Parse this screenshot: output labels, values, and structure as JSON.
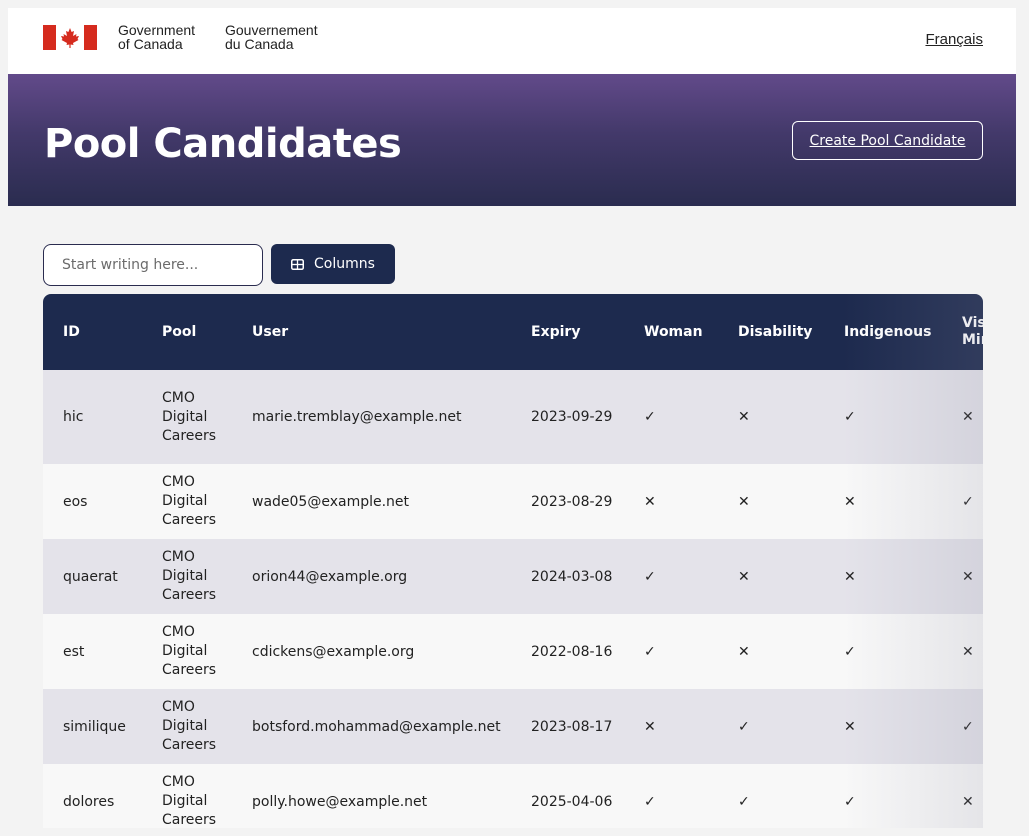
{
  "header": {
    "gov_en_line1": "Government",
    "gov_en_line2": "of Canada",
    "gov_fr_line1": "Gouvernement",
    "gov_fr_line2": "du Canada",
    "language_link": "Français",
    "flag_color": "#d52b1e"
  },
  "hero": {
    "title": "Pool Candidates",
    "create_button": "Create Pool Candidate"
  },
  "controls": {
    "search_placeholder": "Start writing here...",
    "columns_button": "Columns",
    "columns_icon": "table-icon"
  },
  "table": {
    "columns": [
      "ID",
      "Pool",
      "User",
      "Expiry",
      "Woman",
      "Disability",
      "Indigenous",
      "Visible Minority"
    ],
    "rows": [
      {
        "id": "hic",
        "pool": [
          "CMO",
          "Digital",
          "Careers"
        ],
        "user": "marie.tremblay@example.net",
        "expiry": "2023-09-29",
        "woman": "✓",
        "disability": "✕",
        "indigenous": "✓",
        "minority": "✕"
      },
      {
        "id": "eos",
        "pool": [
          "CMO",
          "Digital",
          "Careers"
        ],
        "user": "wade05@example.net",
        "expiry": "2023-08-29",
        "woman": "✕",
        "disability": "✕",
        "indigenous": "✕",
        "minority": "✓"
      },
      {
        "id": "quaerat",
        "pool": [
          "CMO",
          "Digital",
          "Careers"
        ],
        "user": "orion44@example.org",
        "expiry": "2024-03-08",
        "woman": "✓",
        "disability": "✕",
        "indigenous": "✕",
        "minority": "✕"
      },
      {
        "id": "est",
        "pool": [
          "CMO",
          "Digital",
          "Careers"
        ],
        "user": "cdickens@example.org",
        "expiry": "2022-08-16",
        "woman": "✓",
        "disability": "✕",
        "indigenous": "✓",
        "minority": "✕"
      },
      {
        "id": "similique",
        "pool": [
          "CMO",
          "Digital",
          "Careers"
        ],
        "user": "botsford.mohammad@example.net",
        "expiry": "2023-08-17",
        "woman": "✕",
        "disability": "✓",
        "indigenous": "✕",
        "minority": "✓"
      },
      {
        "id": "dolores",
        "pool": [
          "CMO",
          "Digital",
          "Careers"
        ],
        "user": "polly.howe@example.net",
        "expiry": "2025-04-06",
        "woman": "✓",
        "disability": "✓",
        "indigenous": "✓",
        "minority": "✕"
      }
    ]
  },
  "colors": {
    "primary_dark": "#1d2a4e",
    "hero_top": "#624a8a",
    "hero_bottom": "#2a2c4f",
    "row_alt": "#e4e3ea"
  }
}
